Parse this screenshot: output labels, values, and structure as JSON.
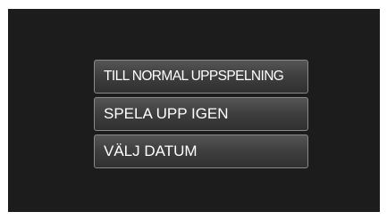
{
  "menu": {
    "items": [
      {
        "label": "TILL NORMAL UPPSPELNING"
      },
      {
        "label": "SPELA UPP IGEN"
      },
      {
        "label": "VÄLJ DATUM"
      }
    ]
  }
}
